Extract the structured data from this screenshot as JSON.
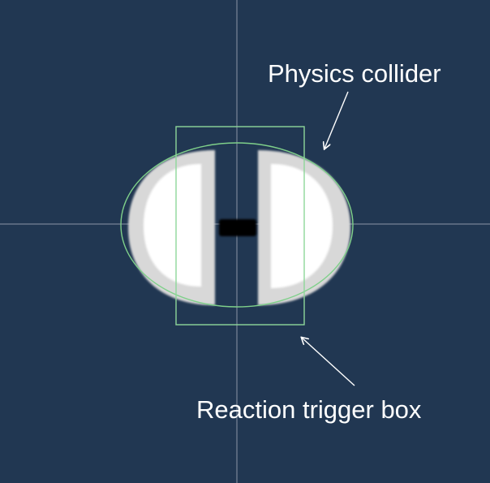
{
  "labels": {
    "physics_collider": "Physics collider",
    "reaction_trigger_box": "Reaction trigger box"
  },
  "colors": {
    "background": "#213752",
    "axis_lines": "#8a96a6",
    "collider_outline": "#7fd08a",
    "trigger_box_outline": "#8ed79a",
    "sprite_rim": "#d8d8d8",
    "sprite_fill": "#ffffff",
    "sprite_connector": "#000000",
    "arrow": "#ffffff",
    "label_text": "#ffffff"
  }
}
